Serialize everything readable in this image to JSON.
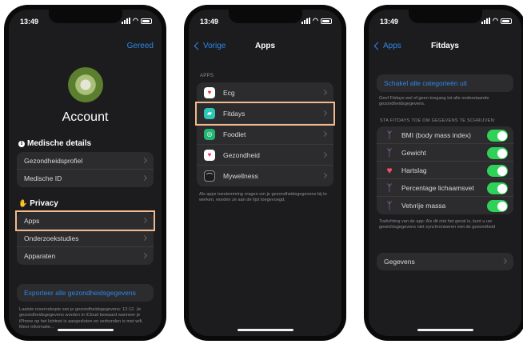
{
  "status": {
    "time": "13:49"
  },
  "screen1": {
    "done": "Gereed",
    "title": "Account",
    "medical_header": "Medische details",
    "medical_items": [
      "Gezondheidsprofiel",
      "Medische ID"
    ],
    "privacy_header": "Privacy",
    "privacy_items": [
      "Apps",
      "Onderzoekstudies",
      "Apparaten"
    ],
    "export": "Exporteer alle gezondheidsgegevens",
    "footnote": "Laatste reservekopie van je gezondheidsgegevens: 12:12. Je gezondheidsgegevens worden in iCloud bewaard wanneer je iPhone op het lichtnet is aangesloten en verbonden is met wifi. Meer informatie..."
  },
  "screen2": {
    "back": "Vorige",
    "title": "Apps",
    "section": "APPS",
    "apps": [
      "Ecg",
      "Fitdays",
      "Foodiet",
      "Gezondheid",
      "Mywellness"
    ],
    "footnote": "Als apps toestemming vragen om je gezondheidsgegevens bij te werken, worden ze aan de lijst toegevoegd."
  },
  "screen3": {
    "back": "Apps",
    "title": "Fitdays",
    "toggle_all": "Schakel alle categorieën uit",
    "desc": "Geef Fitdays wel of geen toegang tot alle onderstaande gezondheidsgegevens.",
    "write_header": "STA FITDAYS TOE OM GEGEVENS TE SCHRIJVEN:",
    "permissions": [
      "BMI (body mass index)",
      "Gewicht",
      "Hartslag",
      "Percentage lichaamsvet",
      "Vetvrije massa"
    ],
    "explanation": "Toelichting van de app: Als dit niet het geval is, kunt u uw gewichtsgegevens niet synchroniseren met de gezondheid",
    "data_label": "Gegevens"
  },
  "colors": {
    "accent": "#2f86e8",
    "highlight": "#f1b98c",
    "toggle_on": "#30d158"
  }
}
